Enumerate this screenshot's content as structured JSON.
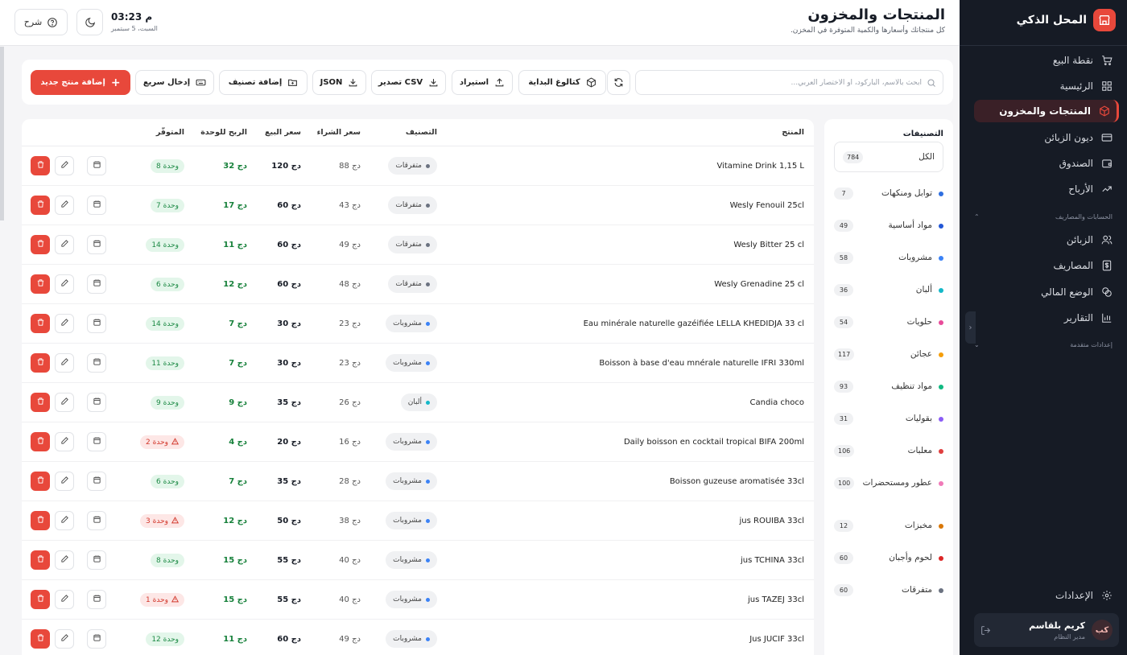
{
  "sidebar": {
    "brand": "المحل الذكي",
    "items": [
      {
        "label": "نقطة البيع",
        "icon": "cart-icon",
        "active": false
      },
      {
        "label": "الرئيسية",
        "icon": "grid-icon",
        "active": false
      },
      {
        "label": "المنتجات والمخزون",
        "icon": "box-icon",
        "active": true
      },
      {
        "label": "ديون الزبائن",
        "icon": "card-icon",
        "active": false
      },
      {
        "label": "الصندوق",
        "icon": "wallet-icon",
        "active": false
      },
      {
        "label": "الأرباح",
        "icon": "trend-up-icon",
        "active": false
      }
    ],
    "section_accounts": "الحسابات والمصاريف",
    "items2": [
      {
        "label": "الزبائن",
        "icon": "users-icon"
      },
      {
        "label": "المصاريف",
        "icon": "dollar-icon"
      },
      {
        "label": "الوضع المالي",
        "icon": "coins-icon"
      },
      {
        "label": "التقارير",
        "icon": "chart-icon"
      }
    ],
    "section_advanced": "إعدادات متقدمة",
    "settings": "الإعدادات",
    "user": {
      "initials": "كب",
      "name": "كريم بلقاسم",
      "role": "مدير النظام"
    }
  },
  "header": {
    "title": "المنتجات والمخزون",
    "subtitle": "كل منتجاتك وأسعارها والكمية المتوفرة في المخزن.",
    "time": "03:23 م",
    "date": "السبت، 5 سبتمبر",
    "explain": "شرح"
  },
  "toolbar": {
    "search_placeholder": "ابحث بالاسم، الباركود، أو الاختصار العربي...",
    "catalog": "كتالوغ البداية",
    "import": "استيراد",
    "export_csv": "تصدير CSV",
    "json": "JSON",
    "add_category": "إضافة تصنيف",
    "quick_entry": "إدخال سريع",
    "add_product": "إضافة منتج جديد"
  },
  "categories": {
    "title": "التصنيفات",
    "all": {
      "label": "الكل",
      "count": "784"
    },
    "items": [
      {
        "name": "توابل ومنكهات",
        "count": "7",
        "color": "#2f6fe0"
      },
      {
        "name": "مواد أساسية",
        "count": "49",
        "color": "#2357d6"
      },
      {
        "name": "مشروبات",
        "count": "58",
        "color": "#3b82f6"
      },
      {
        "name": "ألبان",
        "count": "36",
        "color": "#14b8c8"
      },
      {
        "name": "حلويات",
        "count": "54",
        "color": "#e84c9a"
      },
      {
        "name": "عجائن",
        "count": "117",
        "color": "#f59e0b"
      },
      {
        "name": "مواد تنظيف",
        "count": "93",
        "color": "#10b981"
      },
      {
        "name": "بقوليات",
        "count": "31",
        "color": "#8b5cf6"
      },
      {
        "name": "معلبات",
        "count": "106",
        "color": "#e03e3e"
      },
      {
        "name": "عطور ومستحضرات",
        "count": "100",
        "color": "#f07ab8"
      },
      {
        "name": "مخبزات",
        "count": "12",
        "color": "#d97706"
      },
      {
        "name": "لحوم وأجبان",
        "count": "60",
        "color": "#dc2626"
      },
      {
        "name": "متفرقات",
        "count": "60",
        "color": "#6b7280"
      }
    ]
  },
  "table": {
    "headers": {
      "product": "المنتج",
      "category": "التصنيف",
      "buy": "سعر الشراء",
      "sell": "سعر البيع",
      "profit": "الربح للوحدة",
      "stock": "المتوفّر"
    },
    "rows": [
      {
        "name": "Vitamine Drink 1,15 L",
        "cat": "متفرقات",
        "cat_color": "#6b7280",
        "buy": "88 دج",
        "sell": "120 دج",
        "profit": "32 دج",
        "stock": "8 وحدة",
        "low": false
      },
      {
        "name": "Wesly Fenouil 25cl",
        "cat": "متفرقات",
        "cat_color": "#6b7280",
        "buy": "43 دج",
        "sell": "60 دج",
        "profit": "17 دج",
        "stock": "7 وحدة",
        "low": false
      },
      {
        "name": "Wesly Bitter 25 cl",
        "cat": "متفرقات",
        "cat_color": "#6b7280",
        "buy": "49 دج",
        "sell": "60 دج",
        "profit": "11 دج",
        "stock": "14 وحدة",
        "low": false
      },
      {
        "name": "Wesly Grenadine 25 cl",
        "cat": "متفرقات",
        "cat_color": "#6b7280",
        "buy": "48 دج",
        "sell": "60 دج",
        "profit": "12 دج",
        "stock": "6 وحدة",
        "low": false
      },
      {
        "name": "Eau minérale naturelle gazéifiée LELLA KHEDIDJA 33 cl",
        "cat": "مشروبات",
        "cat_color": "#3b82f6",
        "buy": "23 دج",
        "sell": "30 دج",
        "profit": "7 دج",
        "stock": "14 وحدة",
        "low": false
      },
      {
        "name": "Boisson à base d'eau mnérale naturelle IFRI 330ml",
        "cat": "مشروبات",
        "cat_color": "#3b82f6",
        "buy": "23 دج",
        "sell": "30 دج",
        "profit": "7 دج",
        "stock": "11 وحدة",
        "low": false
      },
      {
        "name": "Candia choco",
        "cat": "ألبان",
        "cat_color": "#14b8c8",
        "buy": "26 دج",
        "sell": "35 دج",
        "profit": "9 دج",
        "stock": "9 وحدة",
        "low": false
      },
      {
        "name": "Daily boisson en cocktail tropical BIFA 200ml",
        "cat": "مشروبات",
        "cat_color": "#3b82f6",
        "buy": "16 دج",
        "sell": "20 دج",
        "profit": "4 دج",
        "stock": "2 وحدة",
        "low": true
      },
      {
        "name": "Boisson guzeuse aromatisée 33cl",
        "cat": "مشروبات",
        "cat_color": "#3b82f6",
        "buy": "28 دج",
        "sell": "35 دج",
        "profit": "7 دج",
        "stock": "6 وحدة",
        "low": false
      },
      {
        "name": "jus ROUIBA 33cl",
        "cat": "مشروبات",
        "cat_color": "#3b82f6",
        "buy": "38 دج",
        "sell": "50 دج",
        "profit": "12 دج",
        "stock": "3 وحدة",
        "low": true
      },
      {
        "name": "jus TCHINA 33cl",
        "cat": "مشروبات",
        "cat_color": "#3b82f6",
        "buy": "40 دج",
        "sell": "55 دج",
        "profit": "15 دج",
        "stock": "8 وحدة",
        "low": false
      },
      {
        "name": "jus TAZEJ 33cl",
        "cat": "مشروبات",
        "cat_color": "#3b82f6",
        "buy": "40 دج",
        "sell": "55 دج",
        "profit": "15 دج",
        "stock": "1 وحدة",
        "low": true
      },
      {
        "name": "Jus JUCIF 33cl",
        "cat": "مشروبات",
        "cat_color": "#3b82f6",
        "buy": "49 دج",
        "sell": "60 دج",
        "profit": "11 دج",
        "stock": "12 وحدة",
        "low": false
      }
    ]
  }
}
